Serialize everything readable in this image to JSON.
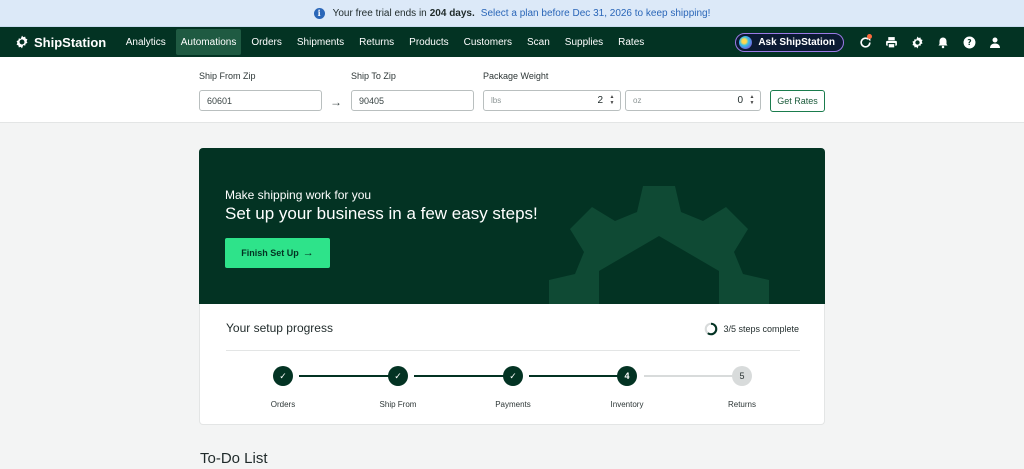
{
  "banner": {
    "prefix": "Your free trial ends in",
    "days": "204 days.",
    "link": "Select a plan before Dec 31, 2026 to keep shipping!"
  },
  "nav": {
    "brand": "ShipStation",
    "items": [
      "Analytics",
      "Automations",
      "Orders",
      "Shipments",
      "Returns",
      "Products",
      "Customers",
      "Scan",
      "Supplies",
      "Rates"
    ],
    "active": "Automations",
    "ask_button": "Ask ShipStation",
    "icons": [
      "refresh-icon",
      "printer-icon",
      "gear-icon",
      "bell-icon",
      "help-icon",
      "user-icon"
    ]
  },
  "rates": {
    "ship_from_label": "Ship From Zip",
    "ship_from_value": "60601",
    "ship_to_label": "Ship To Zip",
    "ship_to_value": "90405",
    "weight_label": "Package Weight",
    "lbs_unit": "lbs",
    "lbs_value": "2",
    "oz_unit": "oz",
    "oz_value": "0",
    "get_rates": "Get Rates"
  },
  "hero": {
    "subtitle": "Make shipping work for you",
    "title": "Set up your business in a few easy steps!",
    "button": "Finish Set Up"
  },
  "progress": {
    "title": "Your setup progress",
    "steps_complete": "3/5 steps complete",
    "completed": 3,
    "total": 5,
    "steps": [
      {
        "label": "Orders",
        "marker": "✓",
        "state": "done"
      },
      {
        "label": "Ship From",
        "marker": "✓",
        "state": "done"
      },
      {
        "label": "Payments",
        "marker": "✓",
        "state": "done"
      },
      {
        "label": "Inventory",
        "marker": "4",
        "state": "current"
      },
      {
        "label": "Returns",
        "marker": "5",
        "state": "todo"
      }
    ]
  },
  "todo": {
    "title": "To-Do List"
  },
  "colors": {
    "brand_dark": "#033323",
    "accent_green": "#2ee38a",
    "banner_bg": "#dce9f8",
    "link_blue": "#2a66b8"
  }
}
